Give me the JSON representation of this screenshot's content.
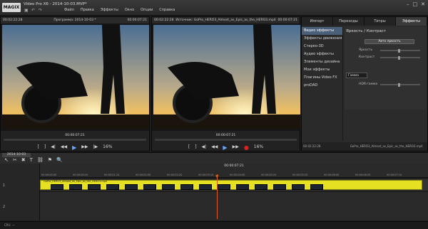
{
  "app": {
    "logo": "MAGIX",
    "title": "Video Pro X6 - 2014-10-03.MVP*",
    "menu": [
      "Файл",
      "Правка",
      "Эффекты",
      "Окно",
      "Опции",
      "Справка"
    ]
  },
  "left_monitor": {
    "time_left": "00:02:22:28",
    "title": "Программа: 2014-10-03 *",
    "time_right": "00:00:07:21",
    "timecode": "00:00:07:21",
    "zoom": "16%"
  },
  "right_monitor": {
    "time_left": "00:02:22:28",
    "title": "Источник: GoPro_HERO3_Almost_as_Epic_as_the_HERO3.mp4",
    "time_right": "00:00:07:21",
    "timecode": "00:00:07:21",
    "zoom": "16%"
  },
  "panel": {
    "tabs": [
      "Импорт",
      "Переходы",
      "Титры",
      "Эффекты"
    ],
    "effects": [
      "Видео эффекты",
      "Эффекты движения",
      "Стерео-3D",
      "Аудио эффекты",
      "Элементы дизайна",
      "Мои эффекты",
      "Плагины Video FX",
      "proDAD"
    ],
    "props_title": "Яркость / Контраст",
    "auto_button": "Авто яркость",
    "rows": [
      "Яркость",
      "Контраст"
    ],
    "gamma_select": "Гамма",
    "gamma_row": "HDR-гамма",
    "bottom_time": "00:02:22:28",
    "bottom_clip": "GoPro_HERO3_Almost_as_Epic_as_the_HERO3.mp4"
  },
  "timeline": {
    "project_tab": "2014-10-03",
    "timecode": "00:00:07:21",
    "ticks": [
      "00:00:00:00",
      "00:00:00:20",
      "00:00:01:10",
      "00:00:02:00",
      "00:00:02:20",
      "00:00:03:10",
      "00:00:04:00",
      "00:00:04:20",
      "00:00:05:10",
      "00:00:06:00",
      "00:00:06:20",
      "00:00:07:10"
    ],
    "clip_name": "GoPro_HERO3_Almost_as_Epic_as_the_HERO3.mp4",
    "track_numbers": [
      "1",
      "2"
    ]
  },
  "status": "CPU: —"
}
